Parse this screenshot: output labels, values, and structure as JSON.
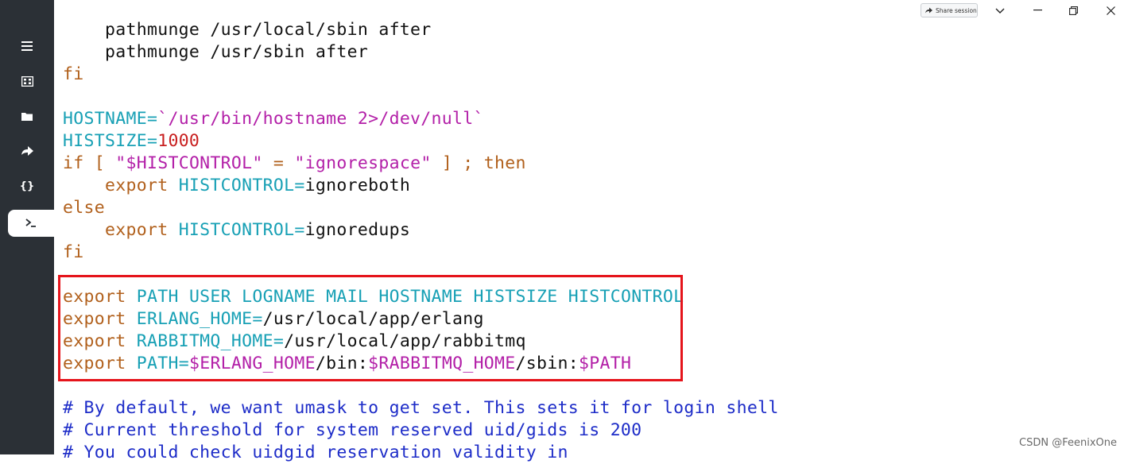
{
  "window": {
    "share_label": "Share session",
    "minimize_icon": "minimize-icon",
    "restore_icon": "restore-icon",
    "close_icon": "close-icon",
    "dropdown_icon": "chevron-down-icon"
  },
  "sidebar": {
    "items": [
      {
        "name": "menu-icon",
        "glyph": "☰"
      },
      {
        "name": "hosts-icon",
        "glyph": "▦"
      },
      {
        "name": "folder-icon",
        "glyph": "▬"
      },
      {
        "name": "forward-icon",
        "glyph": "➦"
      },
      {
        "name": "snippets-icon",
        "glyph": "{}"
      },
      {
        "name": "terminal-icon",
        "glyph": "›_",
        "active": true
      }
    ]
  },
  "editor": {
    "lines": [
      [
        {
          "t": "plain",
          "v": "    pathmunge /usr/local/sbin after"
        }
      ],
      [
        {
          "t": "plain",
          "v": "    pathmunge /usr/sbin after"
        }
      ],
      [
        {
          "t": "kw",
          "v": "fi"
        }
      ],
      [
        {
          "t": "plain",
          "v": ""
        }
      ],
      [
        {
          "t": "var",
          "v": "HOSTNAME="
        },
        {
          "t": "str",
          "v": "`/usr/bin/hostname 2>/dev/null`"
        }
      ],
      [
        {
          "t": "var",
          "v": "HISTSIZE="
        },
        {
          "t": "num",
          "v": "1000"
        }
      ],
      [
        {
          "t": "kw",
          "v": "if [ "
        },
        {
          "t": "str",
          "v": "\"$HISTCONTROL\""
        },
        {
          "t": "kw",
          "v": " = "
        },
        {
          "t": "str",
          "v": "\"ignorespace\""
        },
        {
          "t": "kw",
          "v": " ] ; then"
        }
      ],
      [
        {
          "t": "kw",
          "v": "    export "
        },
        {
          "t": "var",
          "v": "HISTCONTROL="
        },
        {
          "t": "plain",
          "v": "ignoreboth"
        }
      ],
      [
        {
          "t": "kw",
          "v": "else"
        }
      ],
      [
        {
          "t": "kw",
          "v": "    export "
        },
        {
          "t": "var",
          "v": "HISTCONTROL="
        },
        {
          "t": "plain",
          "v": "ignoredups"
        }
      ],
      [
        {
          "t": "kw",
          "v": "fi"
        }
      ],
      [
        {
          "t": "plain",
          "v": ""
        }
      ],
      [
        {
          "t": "kw",
          "v": "export "
        },
        {
          "t": "var",
          "v": "PATH USER LOGNAME MAIL HOSTNAME HISTSIZE HISTCONTROL"
        }
      ],
      [
        {
          "t": "kw",
          "v": "export "
        },
        {
          "t": "var",
          "v": "ERLANG_HOME="
        },
        {
          "t": "plain",
          "v": "/usr/local/app/erlang"
        }
      ],
      [
        {
          "t": "kw",
          "v": "export "
        },
        {
          "t": "var",
          "v": "RABBITMQ_HOME="
        },
        {
          "t": "plain",
          "v": "/usr/local/app/rabbitmq"
        }
      ],
      [
        {
          "t": "kw",
          "v": "export "
        },
        {
          "t": "var",
          "v": "PATH="
        },
        {
          "t": "str",
          "v": "$ERLANG_HOME"
        },
        {
          "t": "plain",
          "v": "/bin:"
        },
        {
          "t": "str",
          "v": "$RABBITMQ_HOME"
        },
        {
          "t": "plain",
          "v": "/sbin:"
        },
        {
          "t": "str",
          "v": "$PATH"
        }
      ],
      [
        {
          "t": "plain",
          "v": ""
        }
      ],
      [
        {
          "t": "cmt",
          "v": "# By default, we want umask to get set. This sets it for login shell"
        }
      ],
      [
        {
          "t": "cmt",
          "v": "# Current threshold for system reserved uid/gids is 200"
        }
      ],
      [
        {
          "t": "cmt",
          "v": "# You could check uidgid reservation validity in"
        }
      ]
    ]
  },
  "watermark": "CSDN @FeenixOne",
  "colors": {
    "sidebar_bg": "#2b3036",
    "keyword": "#b1601c",
    "variable": "#17a0b5",
    "string": "#b320a8",
    "number": "#c81e1e",
    "comment": "#1d2cc8",
    "highlight_box": "#e5141b"
  }
}
